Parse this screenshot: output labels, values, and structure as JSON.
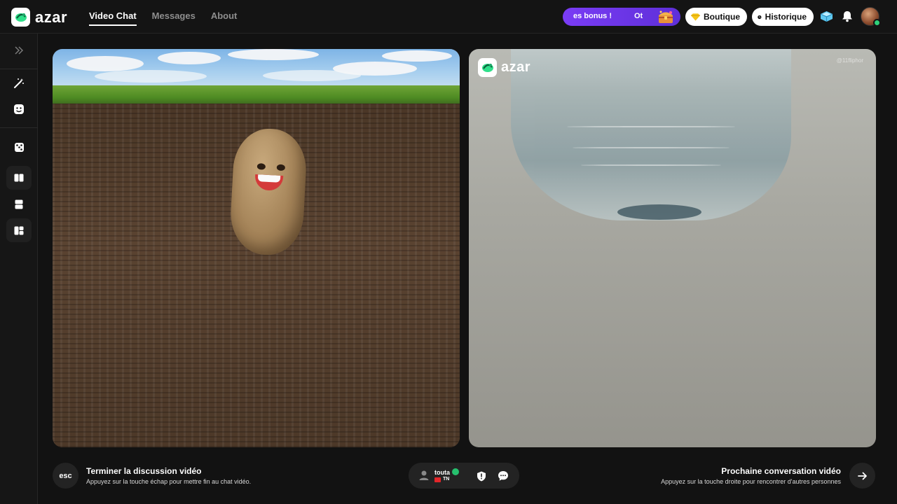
{
  "header": {
    "logo_text": "azar",
    "nav": [
      {
        "label": "Video Chat",
        "active": true
      },
      {
        "label": "Messages",
        "active": false
      },
      {
        "label": "About",
        "active": false
      }
    ],
    "bonus_text": "es bonus !",
    "bonus_text_2": "Ot",
    "shop_label": "Boutique",
    "history_label": "Historique",
    "icons": [
      "gem-icon",
      "clock-icon",
      "gem-cube-icon",
      "bell-icon",
      "avatar"
    ]
  },
  "sidebar": {
    "items": [
      "expand-icon",
      "magic-wand-icon",
      "sticker-icon",
      "dice-icon",
      "layout-side-by-side-icon",
      "layout-stacked-icon",
      "layout-grid-icon"
    ]
  },
  "remote_video": {
    "logo_text": "azar",
    "watermark": "@11fliphor"
  },
  "bottom": {
    "esc_label": "esc",
    "end_title": "Terminer la discussion vidéo",
    "end_subtitle": "Appuyez sur la touche échap pour mettre fin au chat vidéo.",
    "user_name": "touta",
    "user_country": "TN",
    "next_title": "Prochaine conversation vidéo",
    "next_subtitle": "Appuyez sur la touche droite pour rencontrer d'autres personnes"
  },
  "colors": {
    "accent_purple": "#7a3cf5",
    "brand_green": "#2fe08a",
    "verified_green": "#26c06e"
  }
}
